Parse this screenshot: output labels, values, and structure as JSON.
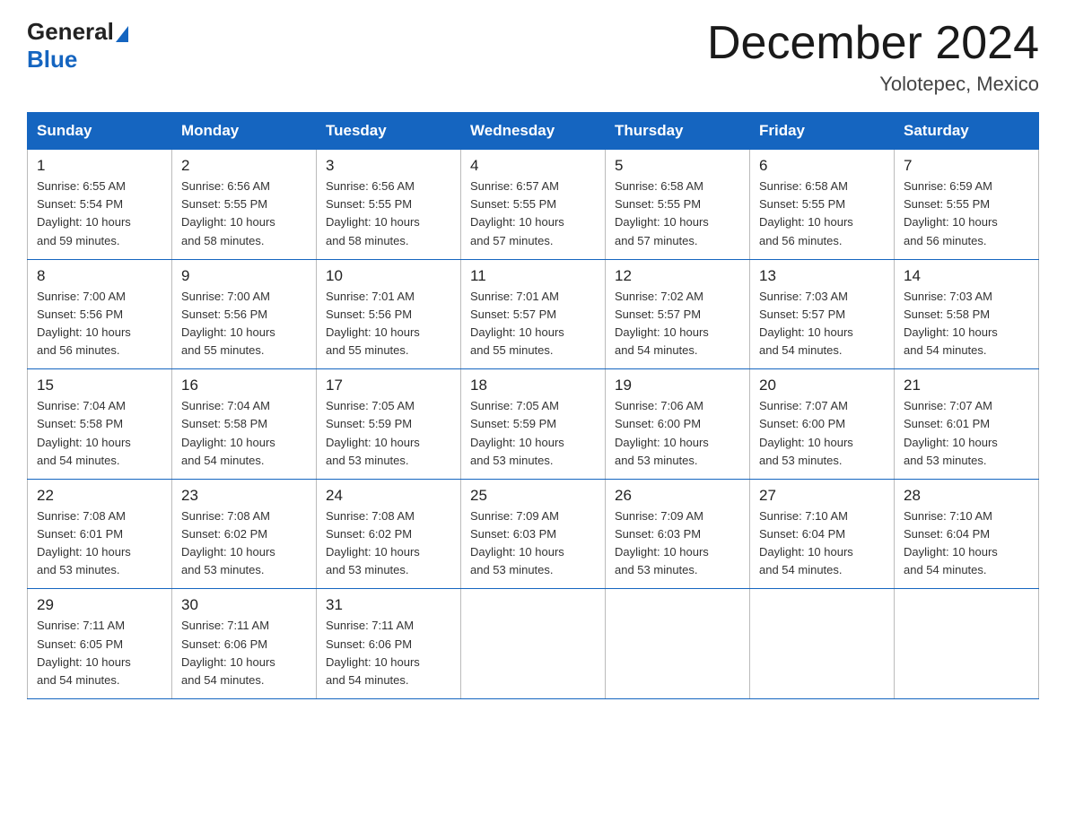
{
  "header": {
    "logo_general": "General",
    "logo_blue": "Blue",
    "month_title": "December 2024",
    "location": "Yolotepec, Mexico"
  },
  "days_of_week": [
    "Sunday",
    "Monday",
    "Tuesday",
    "Wednesday",
    "Thursday",
    "Friday",
    "Saturday"
  ],
  "weeks": [
    [
      {
        "day": "1",
        "sunrise": "6:55 AM",
        "sunset": "5:54 PM",
        "daylight": "10 hours and 59 minutes."
      },
      {
        "day": "2",
        "sunrise": "6:56 AM",
        "sunset": "5:55 PM",
        "daylight": "10 hours and 58 minutes."
      },
      {
        "day": "3",
        "sunrise": "6:56 AM",
        "sunset": "5:55 PM",
        "daylight": "10 hours and 58 minutes."
      },
      {
        "day": "4",
        "sunrise": "6:57 AM",
        "sunset": "5:55 PM",
        "daylight": "10 hours and 57 minutes."
      },
      {
        "day": "5",
        "sunrise": "6:58 AM",
        "sunset": "5:55 PM",
        "daylight": "10 hours and 57 minutes."
      },
      {
        "day": "6",
        "sunrise": "6:58 AM",
        "sunset": "5:55 PM",
        "daylight": "10 hours and 56 minutes."
      },
      {
        "day": "7",
        "sunrise": "6:59 AM",
        "sunset": "5:55 PM",
        "daylight": "10 hours and 56 minutes."
      }
    ],
    [
      {
        "day": "8",
        "sunrise": "7:00 AM",
        "sunset": "5:56 PM",
        "daylight": "10 hours and 56 minutes."
      },
      {
        "day": "9",
        "sunrise": "7:00 AM",
        "sunset": "5:56 PM",
        "daylight": "10 hours and 55 minutes."
      },
      {
        "day": "10",
        "sunrise": "7:01 AM",
        "sunset": "5:56 PM",
        "daylight": "10 hours and 55 minutes."
      },
      {
        "day": "11",
        "sunrise": "7:01 AM",
        "sunset": "5:57 PM",
        "daylight": "10 hours and 55 minutes."
      },
      {
        "day": "12",
        "sunrise": "7:02 AM",
        "sunset": "5:57 PM",
        "daylight": "10 hours and 54 minutes."
      },
      {
        "day": "13",
        "sunrise": "7:03 AM",
        "sunset": "5:57 PM",
        "daylight": "10 hours and 54 minutes."
      },
      {
        "day": "14",
        "sunrise": "7:03 AM",
        "sunset": "5:58 PM",
        "daylight": "10 hours and 54 minutes."
      }
    ],
    [
      {
        "day": "15",
        "sunrise": "7:04 AM",
        "sunset": "5:58 PM",
        "daylight": "10 hours and 54 minutes."
      },
      {
        "day": "16",
        "sunrise": "7:04 AM",
        "sunset": "5:58 PM",
        "daylight": "10 hours and 54 minutes."
      },
      {
        "day": "17",
        "sunrise": "7:05 AM",
        "sunset": "5:59 PM",
        "daylight": "10 hours and 53 minutes."
      },
      {
        "day": "18",
        "sunrise": "7:05 AM",
        "sunset": "5:59 PM",
        "daylight": "10 hours and 53 minutes."
      },
      {
        "day": "19",
        "sunrise": "7:06 AM",
        "sunset": "6:00 PM",
        "daylight": "10 hours and 53 minutes."
      },
      {
        "day": "20",
        "sunrise": "7:07 AM",
        "sunset": "6:00 PM",
        "daylight": "10 hours and 53 minutes."
      },
      {
        "day": "21",
        "sunrise": "7:07 AM",
        "sunset": "6:01 PM",
        "daylight": "10 hours and 53 minutes."
      }
    ],
    [
      {
        "day": "22",
        "sunrise": "7:08 AM",
        "sunset": "6:01 PM",
        "daylight": "10 hours and 53 minutes."
      },
      {
        "day": "23",
        "sunrise": "7:08 AM",
        "sunset": "6:02 PM",
        "daylight": "10 hours and 53 minutes."
      },
      {
        "day": "24",
        "sunrise": "7:08 AM",
        "sunset": "6:02 PM",
        "daylight": "10 hours and 53 minutes."
      },
      {
        "day": "25",
        "sunrise": "7:09 AM",
        "sunset": "6:03 PM",
        "daylight": "10 hours and 53 minutes."
      },
      {
        "day": "26",
        "sunrise": "7:09 AM",
        "sunset": "6:03 PM",
        "daylight": "10 hours and 53 minutes."
      },
      {
        "day": "27",
        "sunrise": "7:10 AM",
        "sunset": "6:04 PM",
        "daylight": "10 hours and 54 minutes."
      },
      {
        "day": "28",
        "sunrise": "7:10 AM",
        "sunset": "6:04 PM",
        "daylight": "10 hours and 54 minutes."
      }
    ],
    [
      {
        "day": "29",
        "sunrise": "7:11 AM",
        "sunset": "6:05 PM",
        "daylight": "10 hours and 54 minutes."
      },
      {
        "day": "30",
        "sunrise": "7:11 AM",
        "sunset": "6:06 PM",
        "daylight": "10 hours and 54 minutes."
      },
      {
        "day": "31",
        "sunrise": "7:11 AM",
        "sunset": "6:06 PM",
        "daylight": "10 hours and 54 minutes."
      },
      null,
      null,
      null,
      null
    ]
  ],
  "labels": {
    "sunrise": "Sunrise:",
    "sunset": "Sunset:",
    "daylight": "Daylight:"
  }
}
